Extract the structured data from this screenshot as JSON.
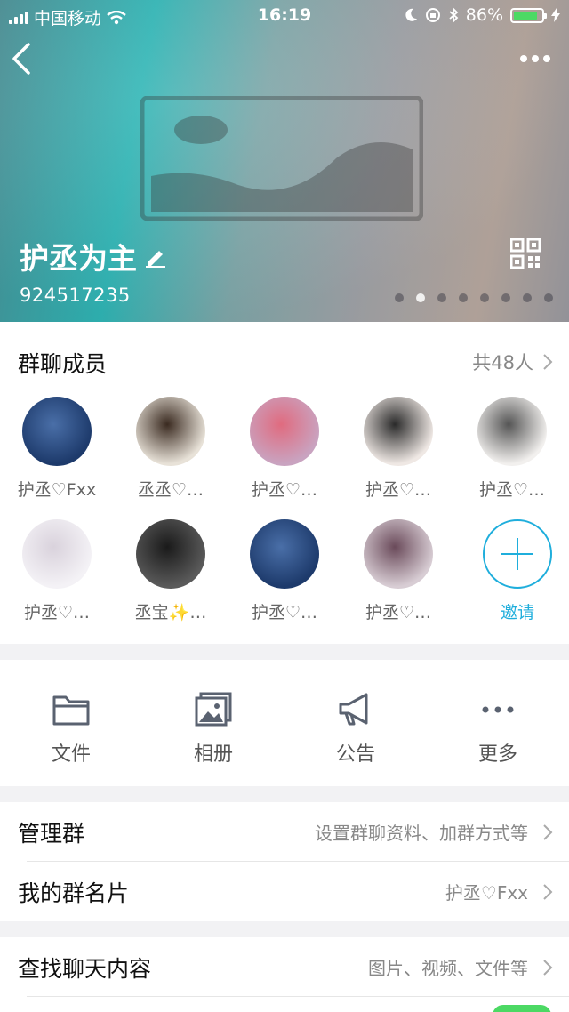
{
  "status_bar": {
    "carrier": "中国移动",
    "time": "16:19",
    "battery_percent": "86%",
    "battery_level": 0.86
  },
  "header": {
    "group_name": "护丞为主",
    "group_id": "924517235",
    "page_dots": 8,
    "active_dot": 1
  },
  "members": {
    "title": "群聊成员",
    "count": "共48人",
    "list": [
      {
        "name": "护丞♡Fxx",
        "colors": [
          "#1d3a6b",
          "#4a6fa8"
        ]
      },
      {
        "name": "丞丞♡…",
        "colors": [
          "#e8e2d8",
          "#3a2a20"
        ]
      },
      {
        "name": "护丞♡…",
        "colors": [
          "#c9a3c0",
          "#e06b7f"
        ]
      },
      {
        "name": "护丞♡…",
        "colors": [
          "#efe8e4",
          "#2a2a2a"
        ]
      },
      {
        "name": "护丞♡…",
        "colors": [
          "#f2f0ee",
          "#555"
        ]
      },
      {
        "name": "护丞♡…",
        "colors": [
          "#f4f2f6",
          "#d9d2dc"
        ]
      },
      {
        "name": "丞宝✨…",
        "colors": [
          "#5a5a5a",
          "#1a1a1a"
        ]
      },
      {
        "name": "护丞♡…",
        "colors": [
          "#1d3a6b",
          "#4a6fa8"
        ]
      },
      {
        "name": "护丞♡…",
        "colors": [
          "#d8cdd4",
          "#6a4a5a"
        ]
      }
    ],
    "invite_label": "邀请"
  },
  "actions": [
    {
      "label": "文件",
      "icon": "folder-icon"
    },
    {
      "label": "相册",
      "icon": "album-icon"
    },
    {
      "label": "公告",
      "icon": "megaphone-icon"
    },
    {
      "label": "更多",
      "icon": "more-dots-icon"
    }
  ],
  "settings": {
    "manage_label": "管理群",
    "manage_value": "设置群聊资料、加群方式等",
    "card_label": "我的群名片",
    "card_value": "护丞♡Fxx",
    "search_label": "查找聊天内容",
    "search_value": "图片、视频、文件等"
  },
  "colors": {
    "accent": "#1faedc",
    "toggle_on": "#4cd964"
  }
}
